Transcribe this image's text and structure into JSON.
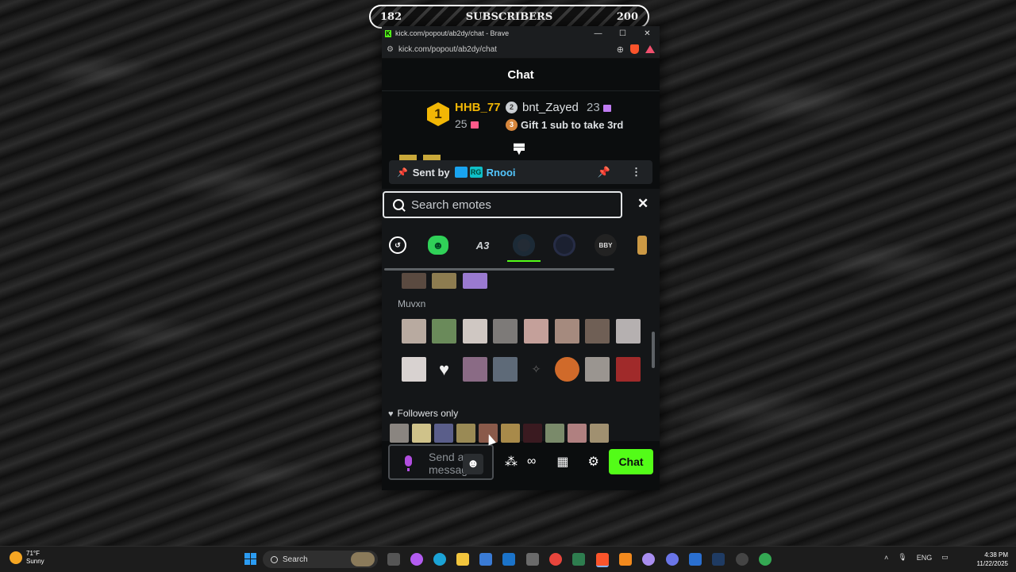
{
  "overlay": {
    "sub_start": "182",
    "sub_title": "SUBSCRIBERS",
    "sub_goal": "200"
  },
  "window": {
    "title": "kick.com/popout/ab2dy/chat - Brave",
    "url": "kick.com/popout/ab2dy/chat",
    "controls": {
      "minimize": "—",
      "maximize": "☐",
      "close": "✕"
    }
  },
  "chat": {
    "header": "Chat",
    "leaderboard": {
      "first": {
        "rank": "1",
        "name": "HHB_77",
        "count": "25"
      },
      "second": {
        "rank": "2",
        "name": "bnt_Zayed",
        "count": "23"
      },
      "third": {
        "rank": "3",
        "text": "Gift 1 sub to take 3rd"
      }
    },
    "pinned": {
      "prefix": "Sent by",
      "badge_text": "RG",
      "sender": "Rnooi"
    }
  },
  "emote_picker": {
    "search_placeholder": "Search emotes",
    "close": "✕",
    "providers": [
      "recent",
      "7tv",
      "A3",
      "channel-1",
      "channel-2",
      "channel-3",
      "channel-4"
    ],
    "provider_a3_label": "A3",
    "provider_ch3_label": "BBY",
    "sections": [
      {
        "name": "Muvxn"
      },
      {
        "name": "Followers only"
      }
    ]
  },
  "composer": {
    "placeholder": "Send a message",
    "chat_button": "Chat"
  },
  "taskbar": {
    "weather_temp": "71°F",
    "weather_cond": "Sunny",
    "search_label": "Search",
    "lang": "ENG",
    "time": "4:38 PM",
    "date": "11/22/2025"
  },
  "colors": {
    "kick_green": "#53fc18",
    "gold": "#f2b705",
    "bronze": "#d7863c",
    "accent_blue": "#53c7ff"
  }
}
